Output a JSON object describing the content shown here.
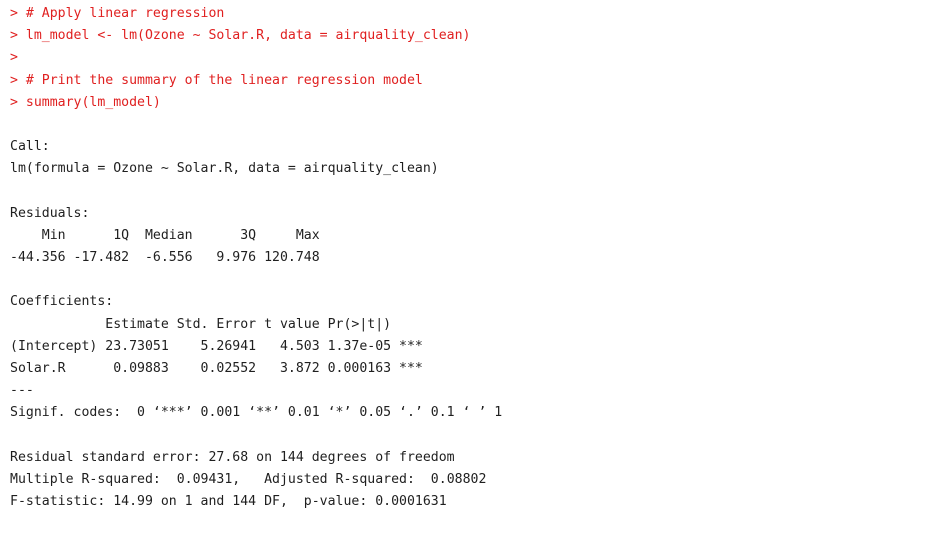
{
  "console": {
    "lines": [
      {
        "type": "input",
        "text": "> # Apply linear regression"
      },
      {
        "type": "input",
        "text": "> lm_model <- lm(Ozone ~ Solar.R, data = airquality_clean)"
      },
      {
        "type": "input",
        "text": ">"
      },
      {
        "type": "input",
        "text": "> # Print the summary of the linear regression model"
      },
      {
        "type": "input",
        "text": "> summary(lm_model)"
      },
      {
        "type": "output",
        "text": ""
      },
      {
        "type": "output",
        "text": "Call:"
      },
      {
        "type": "output",
        "text": "lm(formula = Ozone ~ Solar.R, data = airquality_clean)"
      },
      {
        "type": "output",
        "text": ""
      },
      {
        "type": "output",
        "text": "Residuals:"
      },
      {
        "type": "output",
        "text": "    Min      1Q  Median      3Q     Max "
      },
      {
        "type": "output",
        "text": "-44.356 -17.482  -6.556   9.976 120.748 "
      },
      {
        "type": "output",
        "text": ""
      },
      {
        "type": "output",
        "text": "Coefficients:"
      },
      {
        "type": "output",
        "text": "            Estimate Std. Error t value Pr(>|t|)    "
      },
      {
        "type": "output",
        "text": "(Intercept) 23.73051    5.26941   4.503 1.37e-05 ***"
      },
      {
        "type": "output",
        "text": "Solar.R      0.09883    0.02552   3.872 0.000163 ***"
      },
      {
        "type": "output",
        "text": "---"
      },
      {
        "type": "output",
        "text": "Signif. codes:  0 ‘***’ 0.001 ‘**’ 0.01 ‘*’ 0.05 ‘.’ 0.1 ‘ ’ 1"
      },
      {
        "type": "output",
        "text": ""
      },
      {
        "type": "output",
        "text": "Residual standard error: 27.68 on 144 degrees of freedom"
      },
      {
        "type": "output",
        "text": "Multiple R-squared:  0.09431,\tAdjusted R-squared:  0.08802 "
      },
      {
        "type": "output",
        "text": "F-statistic: 14.99 on 1 and 144 DF,  p-value: 0.0001631"
      }
    ]
  },
  "colors": {
    "input_text": "#e02020",
    "output_text": "#1f1f1f",
    "background": "#ffffff"
  }
}
